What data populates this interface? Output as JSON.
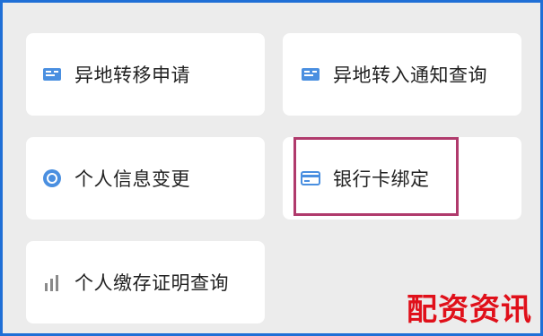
{
  "menu": {
    "items": [
      {
        "label": "异地转移申请",
        "icon": "id-card-icon"
      },
      {
        "label": "异地转入通知查询",
        "icon": "id-card-icon"
      },
      {
        "label": "个人信息变更",
        "icon": "circle-check-icon"
      },
      {
        "label": "银行卡绑定",
        "icon": "bank-card-icon"
      },
      {
        "label": "个人缴存证明查询",
        "icon": "bar-chart-icon"
      }
    ],
    "highlighted_index": 3
  },
  "watermark": {
    "text": "配资资讯"
  },
  "colors": {
    "icon_blue": "#4a8fe0",
    "highlight_border": "#b03a6c",
    "watermark_red": "#e0101a",
    "frame_border": "#1f6fd6"
  }
}
